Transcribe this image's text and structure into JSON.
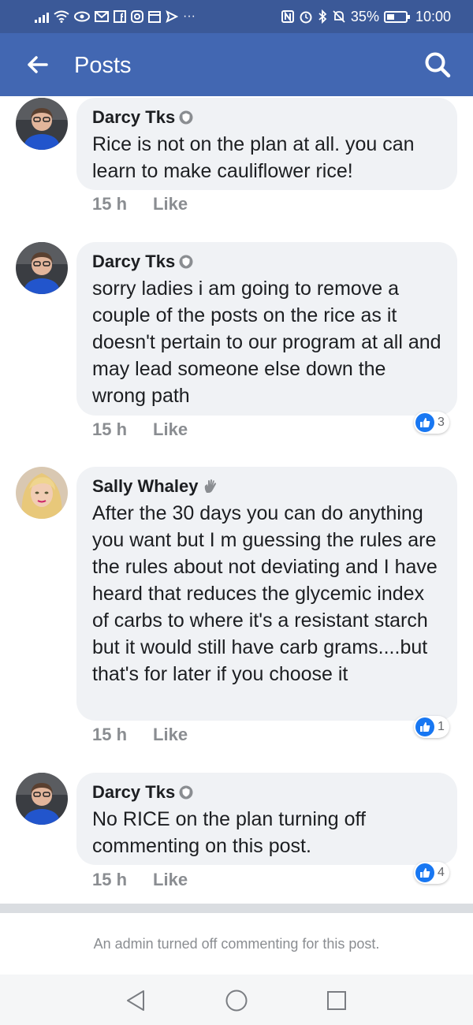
{
  "status_bar": {
    "battery": "35%",
    "time": "10:00",
    "left_icons": [
      "signal-icon",
      "wifi-icon",
      "eye-icon",
      "mail-icon",
      "facebook-icon",
      "instagram-icon",
      "calendar-icon",
      "send-icon",
      "more-icon"
    ],
    "right_icons": [
      "nfc-icon",
      "alarm-icon",
      "bluetooth-icon",
      "mute-icon",
      "battery-icon"
    ]
  },
  "app_bar": {
    "title": "Posts",
    "back_icon": "arrow-left-icon",
    "search_icon": "search-icon"
  },
  "comments": [
    {
      "author": "Darcy Tks",
      "badge_icon": "admin-shield-icon",
      "text": "Rice is not on the plan at all. you can learn to make cauliflower rice!",
      "time": "15 h",
      "like_label": "Like",
      "reaction_count": null
    },
    {
      "author": "Darcy Tks",
      "badge_icon": "admin-shield-icon",
      "text": "sorry ladies i am going to remove a couple of the posts on the rice as it doesn't pertain to our program at all and may lead someone else down the wrong path",
      "time": "15 h",
      "like_label": "Like",
      "reaction_count": "3"
    },
    {
      "author": "Sally Whaley",
      "badge_icon": "wave-icon",
      "text": "After the 30 days you can do anything you want but I m guessing the rules are the rules about not deviating and I have heard that reduces the glycemic index of carbs to where it's a resistant starch but it would still have carb grams....but that's for later if you choose it",
      "time": "15 h",
      "like_label": "Like",
      "reaction_count": "1"
    },
    {
      "author": "Darcy Tks",
      "badge_icon": "admin-shield-icon",
      "text": "No RICE on the plan  turning off commenting on this post.",
      "time": "15 h",
      "like_label": "Like",
      "reaction_count": "4"
    }
  ],
  "closed_notice": "An admin turned off commenting for this post.",
  "nav_bar": {
    "back_icon": "triangle-back-icon",
    "home_icon": "circle-home-icon",
    "recents_icon": "square-recents-icon"
  },
  "colors": {
    "status_bar": "#3b5998",
    "app_bar": "#4267b2",
    "bubble": "#f0f2f5",
    "like_blue": "#1877f2",
    "meta_gray": "#8a8d91"
  }
}
